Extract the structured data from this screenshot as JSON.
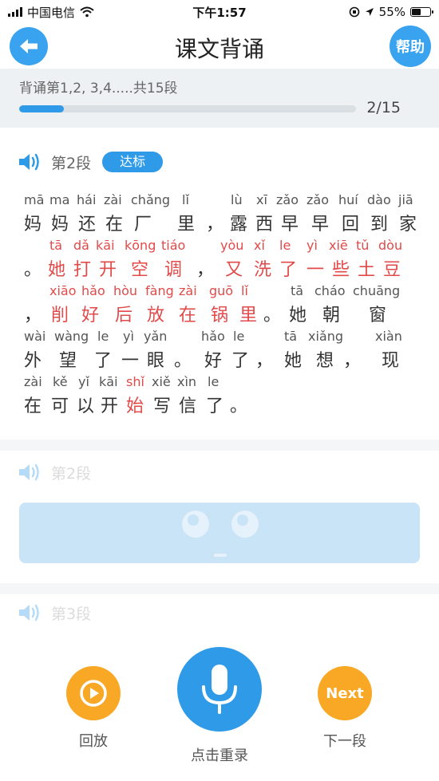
{
  "status_bar": {
    "carrier": "中国电信",
    "time": "下午1:57",
    "battery": "55%",
    "battery_level": 0.55
  },
  "header": {
    "title": "课文背诵",
    "help_label": "帮助"
  },
  "progress": {
    "label": "背诵第1,2, 3,4.....共15段",
    "count": "2/15",
    "fraction": 0.1333
  },
  "section1": {
    "label": "第2段",
    "badge": "达标",
    "rows": [
      {
        "pinyin": [
          "mā",
          "ma",
          "hái",
          "zài",
          "chǎng",
          "lǐ",
          "lù",
          "xī",
          "zǎo",
          "zǎo",
          "huí",
          "dào",
          "jiā"
        ],
        "hanzi": [
          "妈",
          "妈",
          "还",
          "在",
          "厂",
          "里",
          "，",
          "露",
          "西",
          "早",
          "早",
          "回",
          "到",
          "家"
        ]
      },
      {
        "pinyin": [
          "tā",
          "dǎ",
          "kāi",
          "kōng",
          "tiáo",
          "yòu",
          "xǐ",
          "le",
          "yì",
          "xiē",
          "tǔ",
          "dòu"
        ],
        "hanzi": [
          "。",
          "她",
          "打",
          "开",
          "空",
          "调",
          "，",
          "又",
          "洗",
          "了",
          "一",
          "些",
          "土",
          "豆"
        ]
      },
      {
        "pinyin": [
          "xiāo",
          "hǎo",
          "hòu",
          "fàng",
          "zài",
          "guō",
          "lǐ",
          "tā",
          "cháo",
          "chuāng"
        ],
        "hanzi": [
          "，",
          "削",
          "好",
          "后",
          "放",
          "在",
          "锅",
          "里",
          "。",
          "她",
          "朝",
          "窗"
        ]
      },
      {
        "pinyin": [
          "wài",
          "wàng",
          "le",
          "yì",
          "yǎn",
          "hǎo",
          "le",
          "tā",
          "xiǎng",
          "xiàn"
        ],
        "hanzi": [
          "外",
          "望",
          "了",
          "一",
          "眼",
          "。",
          "好",
          "了",
          "，",
          "她",
          "想",
          "，",
          "现"
        ]
      },
      {
        "pinyin": [
          "zài",
          "kě",
          "yǐ",
          "kāi",
          "shǐ",
          "xiě",
          "xìn",
          "le"
        ],
        "hanzi": [
          "在",
          "可",
          "以",
          "开",
          "始",
          "写",
          "信",
          "了",
          "。"
        ]
      }
    ]
  },
  "section2": {
    "label": "第2段"
  },
  "section3": {
    "label": "第3段"
  },
  "bottom": {
    "replay_label": "回放",
    "record_label": "点击重录",
    "next_icon_text": "Next",
    "next_label": "下一段"
  },
  "colors": {
    "accent_blue": "#2f9be8",
    "orange": "#f9a825",
    "error_red": "#e24a4a"
  },
  "icons": [
    "back-arrow-icon",
    "speaker-icon",
    "play-icon",
    "microphone-icon",
    "wifi-icon",
    "signal-icon",
    "battery-icon"
  ]
}
